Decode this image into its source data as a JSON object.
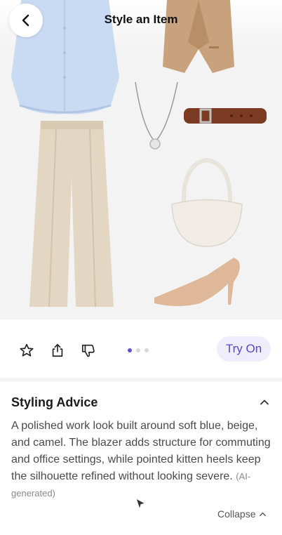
{
  "header": {
    "title": "Style an Item"
  },
  "icons": {
    "back": "chevron-left-icon",
    "favorite": "star-icon",
    "share": "share-icon",
    "dislike": "thumbs-down-icon",
    "expand": "chevron-up-icon"
  },
  "gallery": {
    "page_count": 3,
    "active_page": 1
  },
  "actions": {
    "try_on_label": "Try On"
  },
  "advice": {
    "title": "Styling Advice",
    "body": "A polished work look built around soft blue, beige, and camel. The blazer adds structure for commuting and office settings, while pointed kitten heels keep the silhouette refined without looking severe.",
    "ai_note": "(AI-generated)",
    "collapse_label": "Collapse"
  },
  "colors": {
    "accent": "#6a4fd0",
    "try_on_bg": "#efedfb"
  }
}
